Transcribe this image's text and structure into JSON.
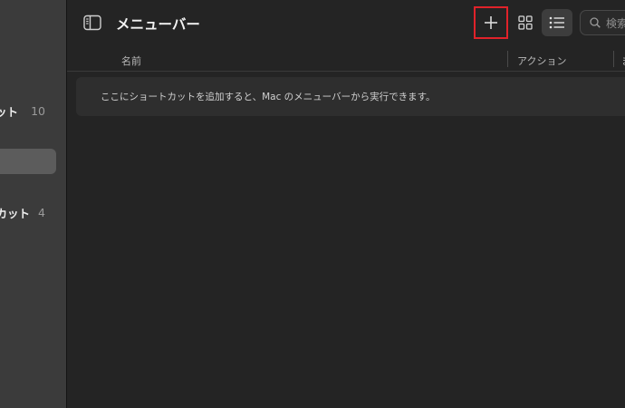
{
  "sidebar": {
    "items": [
      {
        "label": "ット",
        "count": "10"
      },
      {
        "label": "",
        "count": ""
      },
      {
        "label": "カット",
        "count": "4"
      }
    ]
  },
  "toolbar": {
    "title": "メニューバー",
    "search_placeholder": "検索"
  },
  "table": {
    "columns": [
      "名前",
      "アクション",
      "ま"
    ],
    "empty_message": "ここにショートカットを追加すると、Mac のメニューバーから実行できます。"
  },
  "icons": {
    "sidebar_toggle": "sidebar-toggle-icon",
    "add": "plus-icon",
    "grid": "grid-icon",
    "list": "list-icon",
    "search": "magnifier-icon"
  },
  "colors": {
    "highlight_border": "#e1222a",
    "sidebar_bg": "#3b3b3b",
    "main_bg": "#242424"
  }
}
